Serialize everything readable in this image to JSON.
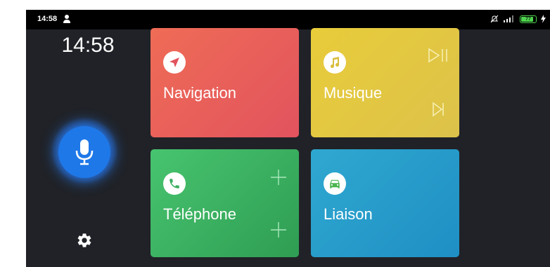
{
  "status_bar": {
    "time": "14:58",
    "battery_level": "77"
  },
  "clock": "14:58",
  "tiles": {
    "navigation": {
      "label": "Navigation"
    },
    "music": {
      "label": "Musique"
    },
    "phone": {
      "label": "Téléphone"
    },
    "link": {
      "label": "Liaison"
    }
  },
  "colors": {
    "navigation": "#e55e5c",
    "music": "#e2c840",
    "phone": "#3cb261",
    "link": "#279cca",
    "mic": "#1f78e8",
    "background": "#202227"
  },
  "icons": {
    "navigation": "navigation-arrow-icon",
    "music": "music-note-icon",
    "phone": "phone-icon",
    "link": "car-icon",
    "mic": "microphone-icon",
    "settings": "gear-icon"
  }
}
